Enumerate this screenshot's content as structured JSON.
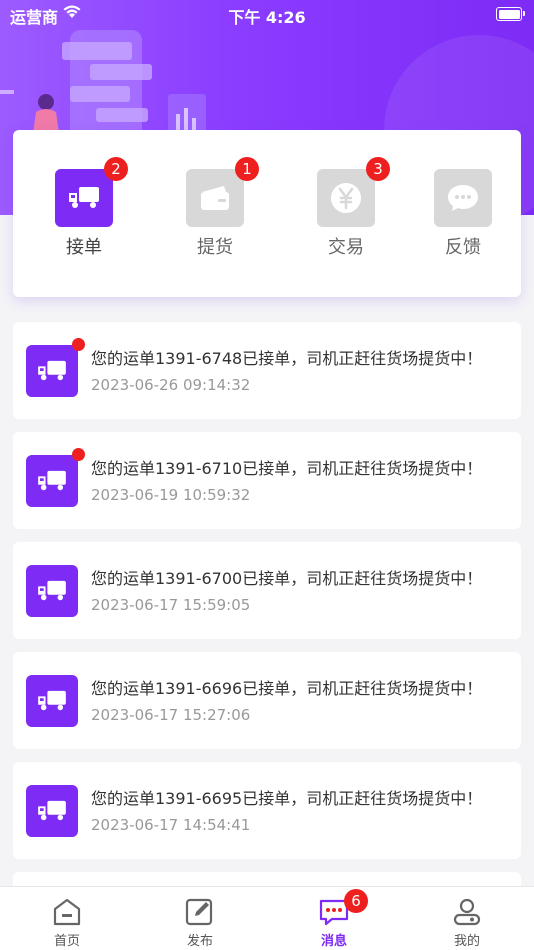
{
  "status_bar": {
    "carrier": "运营商",
    "time": "下午 4:26"
  },
  "categories": [
    {
      "label": "接单",
      "badge": "2",
      "icon": "truck-icon",
      "active": true
    },
    {
      "label": "提货",
      "badge": "1",
      "icon": "wallet-icon",
      "active": false
    },
    {
      "label": "交易",
      "badge": "3",
      "icon": "yuan-icon",
      "active": false
    },
    {
      "label": "反馈",
      "badge": "",
      "icon": "chat-bubble-icon",
      "active": false
    }
  ],
  "messages": [
    {
      "text": "您的运单1391-6748已接单，司机正赶往货场提货中！",
      "time": "2023-06-26 09:14:32",
      "unread": true
    },
    {
      "text": "您的运单1391-6710已接单，司机正赶往货场提货中！",
      "time": "2023-06-19 10:59:32",
      "unread": true
    },
    {
      "text": "您的运单1391-6700已接单，司机正赶往货场提货中！",
      "time": "2023-06-17 15:59:05",
      "unread": false
    },
    {
      "text": "您的运单1391-6696已接单，司机正赶往货场提货中！",
      "time": "2023-06-17 15:27:06",
      "unread": false
    },
    {
      "text": "您的运单1391-6695已接单，司机正赶往货场提货中！",
      "time": "2023-06-17 14:54:41",
      "unread": false
    }
  ],
  "tabbar": [
    {
      "label": "首页",
      "icon": "home-icon",
      "active": false,
      "badge": ""
    },
    {
      "label": "发布",
      "icon": "edit-icon",
      "active": false,
      "badge": ""
    },
    {
      "label": "消息",
      "icon": "message-icon",
      "active": true,
      "badge": "6"
    },
    {
      "label": "我的",
      "icon": "profile-icon",
      "active": false,
      "badge": ""
    }
  ],
  "colors": {
    "accent": "#7d2bf5",
    "badge": "#ee1f1f",
    "inactive_icon": "#d8d8d8"
  }
}
